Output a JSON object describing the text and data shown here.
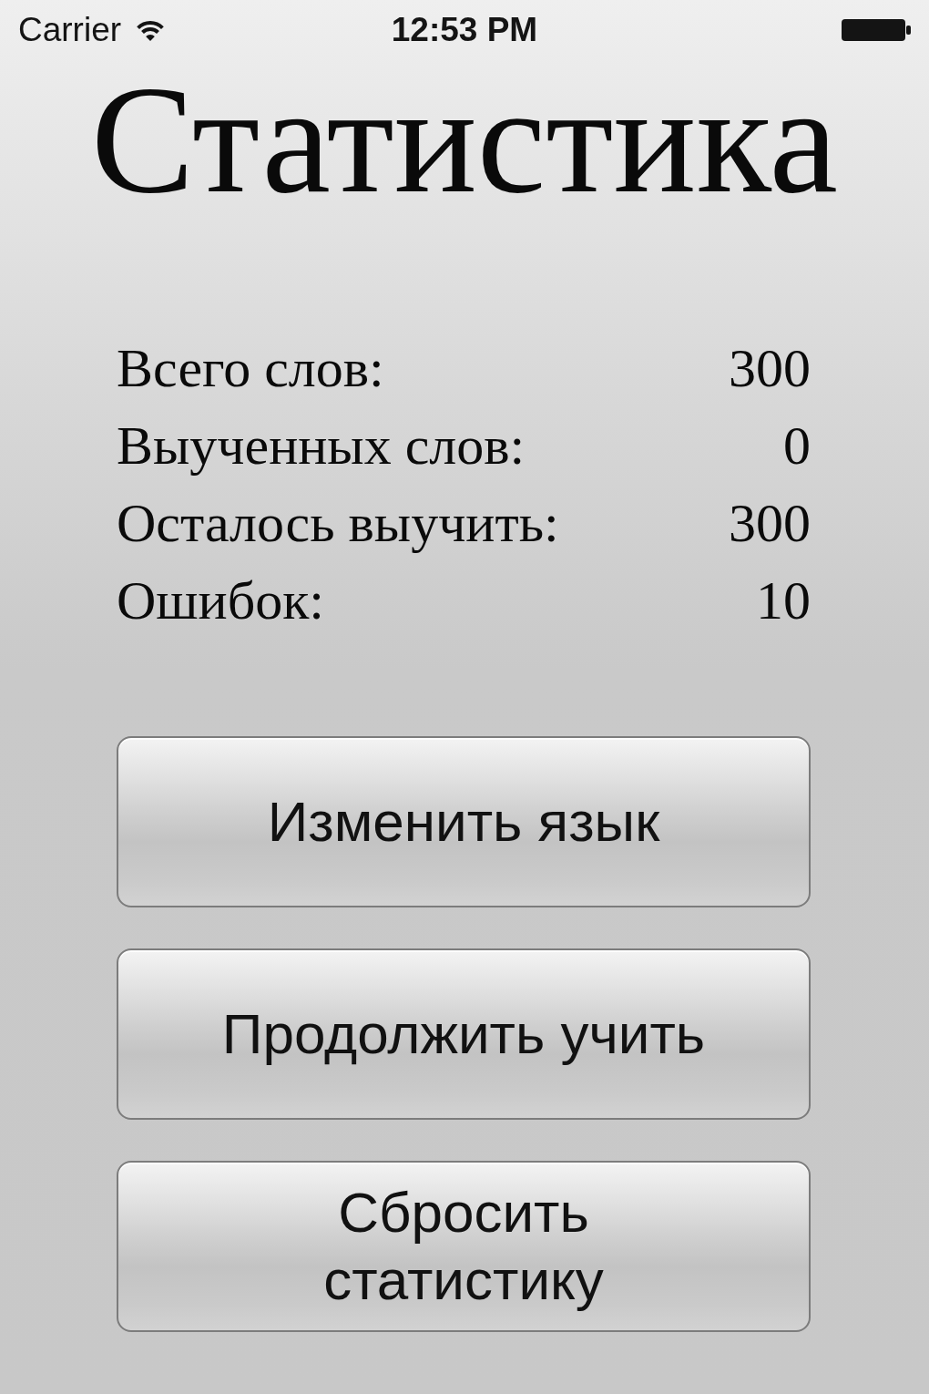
{
  "status_bar": {
    "carrier": "Carrier",
    "time": "12:53 PM"
  },
  "title": "Статистика",
  "stats": [
    {
      "label": "Всего слов:",
      "value": "300"
    },
    {
      "label": "Выученных слов:",
      "value": "0"
    },
    {
      "label": "Осталось выучить:",
      "value": "300"
    },
    {
      "label": "Ошибок:",
      "value": "10"
    }
  ],
  "buttons": [
    "Изменить язык",
    "Продолжить учить",
    "Сбросить статистику"
  ]
}
